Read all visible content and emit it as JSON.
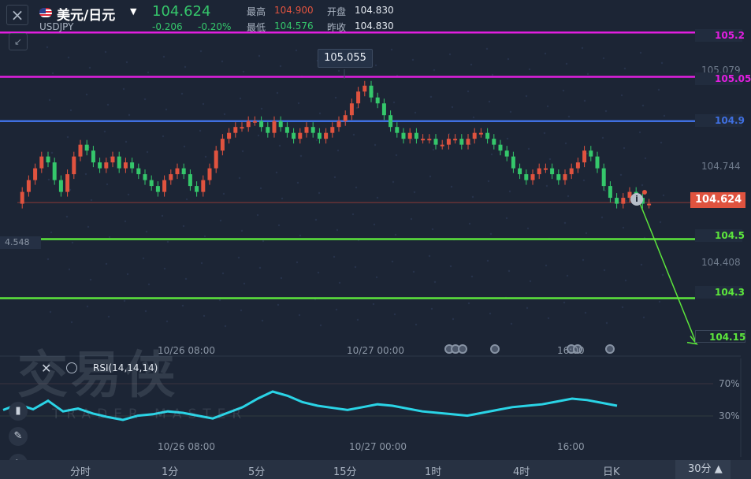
{
  "header": {
    "close_icon": "×",
    "symbol_name": "美元/日元",
    "symbol_code": "USDJPY",
    "last_price": "104.624",
    "change": "-0.206",
    "change_pct": "-0.20%",
    "high_label": "最高",
    "high_value": "104.900",
    "low_label": "最低",
    "low_value": "104.576",
    "open_label": "开盘",
    "open_value": "104.830",
    "prev_close_label": "昨收",
    "prev_close_value": "104.830"
  },
  "colors": {
    "up": "#35c76b",
    "down": "#e0533f",
    "level_magenta": "#e21ee0",
    "level_blue": "#3f6fe0",
    "level_green": "#5ce63c",
    "rsi_line": "#2ad4e6",
    "background": "#1c2535"
  },
  "chart": {
    "tooltip": "105.055",
    "current_price_tag": "104.624",
    "left_price": "4.548",
    "levels": [
      {
        "label": "105.2",
        "value": 105.2,
        "color": "magenta"
      },
      {
        "label": "105.05",
        "value": 105.05,
        "color": "magenta"
      },
      {
        "label": "104.9",
        "value": 104.9,
        "color": "blue"
      },
      {
        "label": "104.5",
        "value": 104.5,
        "color": "green"
      },
      {
        "label": "104.3",
        "value": 104.3,
        "color": "green"
      }
    ],
    "target_label": "104.15",
    "y_ticks": [
      "105.079",
      "104.744",
      "104.408"
    ],
    "time_labels": [
      "10/26 08:00",
      "10/27 00:00",
      "16:00"
    ]
  },
  "rsi": {
    "title": "RSI(14,14,14)",
    "levels": [
      "70%",
      "30%"
    ],
    "time_labels": [
      "10/26 08:00",
      "10/27 00:00",
      "16:00"
    ]
  },
  "bottom_bar": {
    "items": [
      "分时",
      "1分",
      "5分",
      "15分",
      "1时",
      "4时",
      "日K"
    ],
    "selected": "30分",
    "selected_caret": "▲"
  },
  "watermark": {
    "main": "交易侠",
    "sub": "TRADER MASTER"
  }
}
